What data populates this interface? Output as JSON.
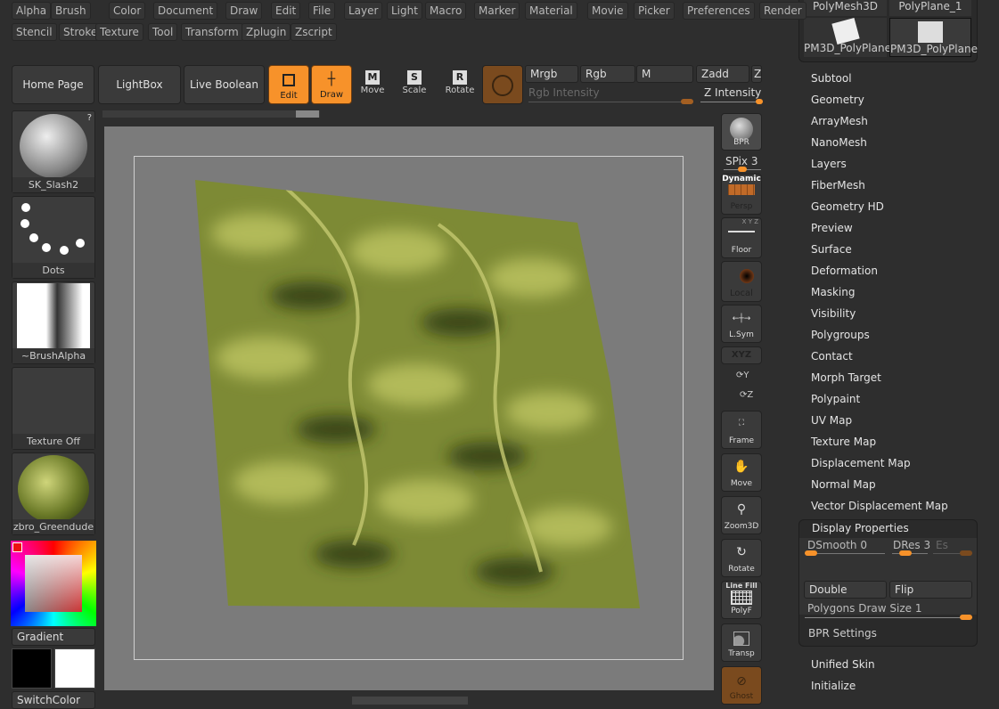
{
  "menu_row1": [
    "Alpha",
    "Brush",
    "Color",
    "Document",
    "Draw",
    "Edit",
    "File",
    "Layer",
    "Light",
    "Macro",
    "Marker",
    "Material",
    "Movie",
    "Picker",
    "Preferences",
    "Render"
  ],
  "menu_row2": [
    "Stencil",
    "Stroke",
    "Texture",
    "Tool",
    "Transform",
    "Zplugin",
    "Zscript"
  ],
  "toolbar": {
    "home": "Home Page",
    "lightbox": "LightBox",
    "live_boolean": "Live Boolean",
    "edit": "Edit",
    "draw": "Draw",
    "move": "Move",
    "scale": "Scale",
    "rotate": "Rotate",
    "mrgb": "Mrgb",
    "rgb": "Rgb",
    "m": "M",
    "zadd": "Zadd",
    "zsub": "Zs",
    "rgb_intensity": "Rgb Intensity",
    "z_intensity": "Z Intensity"
  },
  "left": {
    "brush": "SK_Slash2",
    "stroke": "Dots",
    "alpha": "~BrushAlpha",
    "texture": "Texture Off",
    "material": "zbro_Greendude",
    "gradient": "Gradient",
    "switch": "SwitchColor",
    "help": "?"
  },
  "shelf": {
    "bpr": "BPR",
    "spix": "SPix 3",
    "persp_top": "Dynamic",
    "persp": "Persp",
    "floor": "Floor",
    "floor_axes": "X Y Z",
    "local": "Local",
    "lsym": "L.Sym",
    "xyz": "XYZ",
    "y": "Y",
    "z": "Z",
    "frame": "Frame",
    "move": "Move",
    "zoom3d": "Zoom3D",
    "rotate": "Rotate",
    "polyf_top": "Line Fill",
    "polyf": "PolyF",
    "transp": "Transp",
    "ghost": "Ghost"
  },
  "tools": [
    "PolyMesh3D",
    "PolyPlane_1",
    "PM3D_PolyPlane",
    "PM3D_PolyPlane"
  ],
  "tool_menu": [
    "Subtool",
    "Geometry",
    "ArrayMesh",
    "NanoMesh",
    "Layers",
    "FiberMesh",
    "Geometry HD",
    "Preview",
    "Surface",
    "Deformation",
    "Masking",
    "Visibility",
    "Polygroups",
    "Contact",
    "Morph Target",
    "Polypaint",
    "UV Map",
    "Texture Map",
    "Displacement Map",
    "Normal Map",
    "Vector Displacement Map"
  ],
  "display_properties": {
    "title": "Display Properties",
    "dsmooth": "DSmooth 0",
    "dres": "DRes 3",
    "es": "Es",
    "double": "Double",
    "flip": "Flip",
    "poly_draw_size": "Polygons Draw Size 1",
    "bpr_settings": "BPR Settings"
  },
  "tool_menu_after": [
    "Unified Skin",
    "Initialize"
  ],
  "colors": {
    "accent": "#f7922a",
    "mesh": "#7d8a35"
  }
}
